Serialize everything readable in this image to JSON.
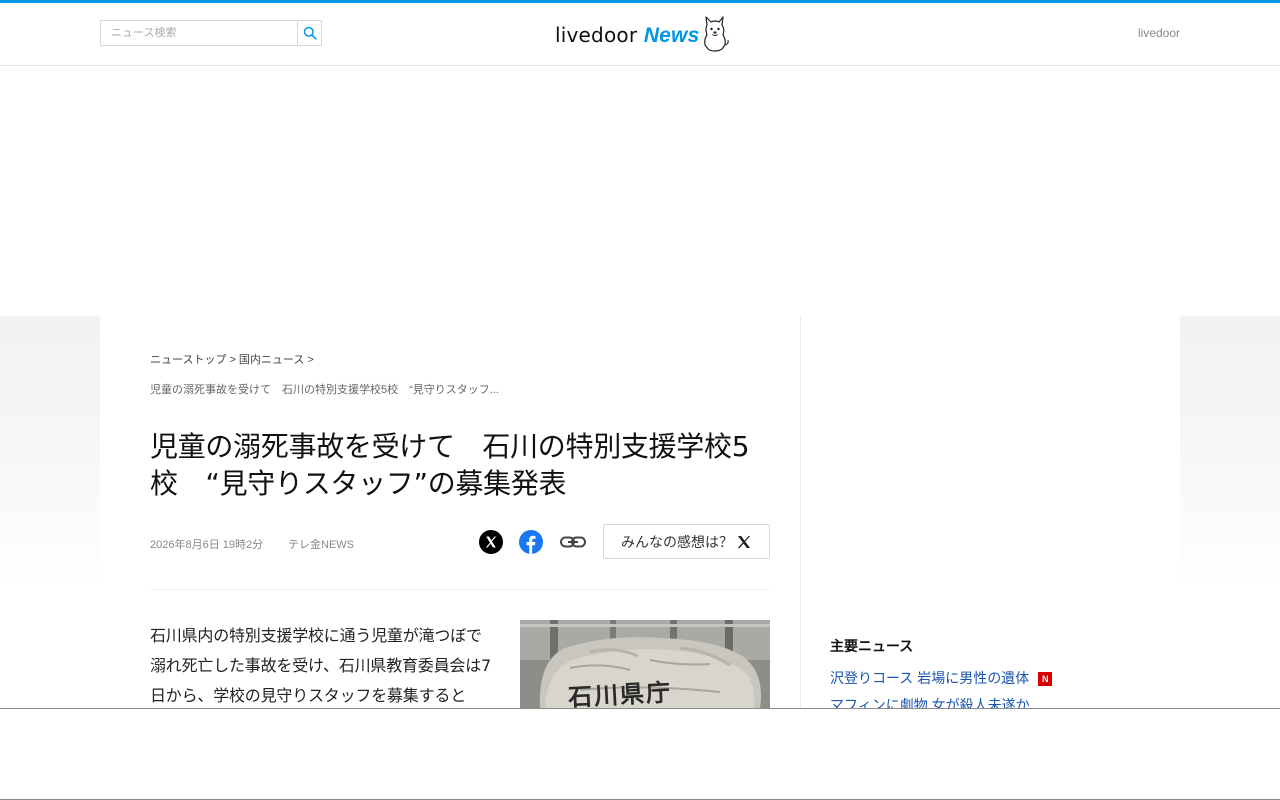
{
  "search": {
    "placeholder": "ニュース検索"
  },
  "logo": {
    "brand": "livedoor",
    "news": "News"
  },
  "header": {
    "link": "livedoor"
  },
  "breadcrumb": {
    "items": [
      "ニューストップ",
      "国内ニュース"
    ],
    "separator": ">",
    "current": "児童の溺死事故を受けて　石川の特別支援学校5校　“見守りスタッフ..."
  },
  "article": {
    "title": "児童の溺死事故を受けて　石川の特別支援学校5校　“見守りスタッフ”の募集発表",
    "date": "2026年8月6日 19時2分",
    "source": "テレ金NEWS",
    "body": "石川県内の特別支援学校に通う児童が滝つぼで溺れ死亡した事故を受け、石川県教育委員会は7日から、学校の見守りスタッフを募集すると",
    "image_caption": "石川県庁"
  },
  "share": {
    "opinion_label": "みんなの感想は？"
  },
  "sidebar": {
    "heading": "主要ニュース",
    "items": [
      {
        "label": "沢登りコース 岩場に男性の遺体",
        "badge": "N"
      },
      {
        "label": "マフィンに劇物 女が殺人未遂か"
      }
    ]
  },
  "colors": {
    "accent": "#0096e6",
    "link": "#1a55b0",
    "badge": "#d40000"
  }
}
